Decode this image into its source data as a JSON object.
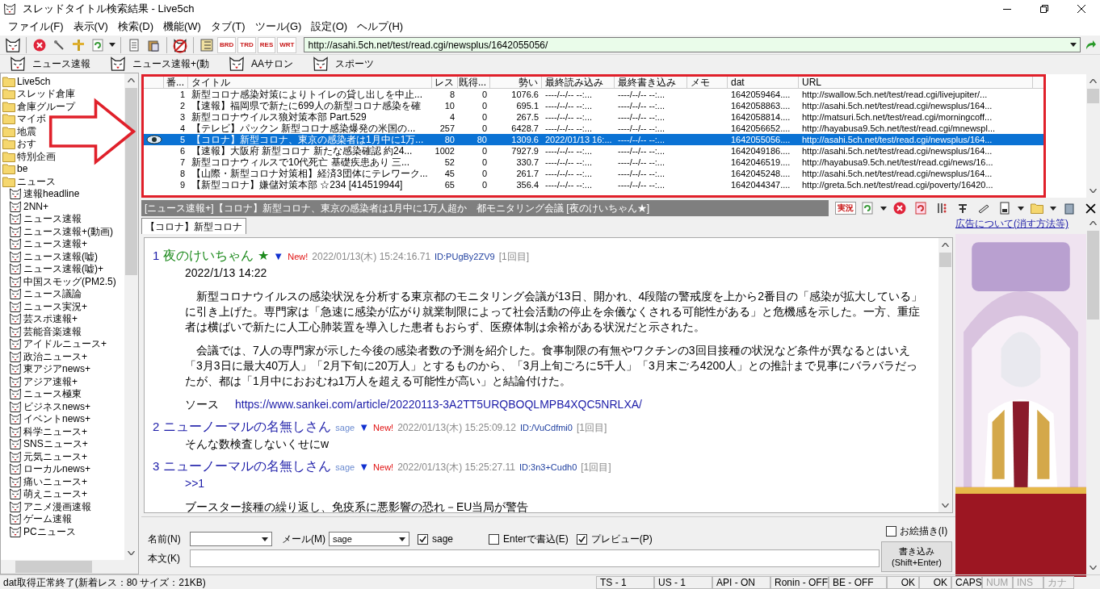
{
  "window": {
    "title": "スレッドタイトル検索結果 - Live5ch"
  },
  "menu": [
    "ファイル(F)",
    "表示(V)",
    "検索(D)",
    "機能(W)",
    "タブ(T)",
    "ツール(G)",
    "設定(O)",
    "ヘルプ(H)"
  ],
  "toolbar": {
    "letter_buttons": [
      "BRD",
      "TRD",
      "RES",
      "WRT"
    ],
    "address": "http://asahi.5ch.net/test/read.cgi/newsplus/1642055056/"
  },
  "favorites": [
    "ニュース速報",
    "ニュース速報+(動",
    "AAサロン",
    "スポーツ"
  ],
  "sidebar": {
    "items": [
      {
        "label": "Live5ch",
        "kind": "folder"
      },
      {
        "label": "スレッド倉庫",
        "kind": "folder"
      },
      {
        "label": "倉庫グループ",
        "kind": "folder"
      },
      {
        "label": "マイボ",
        "kind": "folder"
      },
      {
        "label": "地震",
        "kind": "folder"
      },
      {
        "label": "おす",
        "kind": "folder"
      },
      {
        "label": "特別企画",
        "kind": "folder"
      },
      {
        "label": "be",
        "kind": "folder"
      },
      {
        "label": "ニュース",
        "kind": "folder",
        "children": [
          {
            "label": "速報headline",
            "kind": "board"
          },
          {
            "label": "2NN+",
            "kind": "board"
          },
          {
            "label": "ニュース速報",
            "kind": "board"
          },
          {
            "label": "ニュース速報+(動画)",
            "kind": "board"
          },
          {
            "label": "ニュース速報+",
            "kind": "board"
          },
          {
            "label": "ニュース速報(嘘)",
            "kind": "board"
          },
          {
            "label": "ニュース速報(嘘)+",
            "kind": "board"
          },
          {
            "label": "中国スモッグ(PM2.5)",
            "kind": "board"
          },
          {
            "label": "ニュース議論",
            "kind": "board"
          },
          {
            "label": "ニュース実況+",
            "kind": "board"
          },
          {
            "label": "芸スポ速報+",
            "kind": "board"
          },
          {
            "label": "芸能音楽速報",
            "kind": "board"
          },
          {
            "label": "アイドルニュース+",
            "kind": "board"
          },
          {
            "label": "政治ニュース+",
            "kind": "board"
          },
          {
            "label": "東アジアnews+",
            "kind": "board"
          },
          {
            "label": "アジア速報+",
            "kind": "board"
          },
          {
            "label": "ニュース極東",
            "kind": "board"
          },
          {
            "label": "ビジネスnews+",
            "kind": "board"
          },
          {
            "label": "イベントnews+",
            "kind": "board"
          },
          {
            "label": "科学ニュース+",
            "kind": "board"
          },
          {
            "label": "SNSニュース+",
            "kind": "board"
          },
          {
            "label": "元気ニュース+",
            "kind": "board"
          },
          {
            "label": "ローカルnews+",
            "kind": "board"
          },
          {
            "label": "痛いニュース+",
            "kind": "board"
          },
          {
            "label": "萌えニュース+",
            "kind": "board"
          },
          {
            "label": "アニメ漫画速報",
            "kind": "board"
          },
          {
            "label": "ゲーム速報",
            "kind": "board"
          },
          {
            "label": "PCニュース",
            "kind": "board"
          }
        ]
      }
    ]
  },
  "table": {
    "columns": [
      "番...",
      "タイトル",
      "レス",
      "既得...",
      "勢い",
      "最終読み込み",
      "最終書き込み",
      "メモ",
      "dat",
      "URL"
    ],
    "rows": [
      {
        "no": "1",
        "title": "新型コロナ感染対策によりトイレの貸し出しを中止...",
        "res": "8",
        "got": "0",
        "momentum": "1076.6",
        "last_read": "----/--/-- --:...",
        "last_write": "----/--/-- --:...",
        "dat": "1642059464....",
        "url": "http://swallow.5ch.net/test/read.cgi/livejupiter/...",
        "selected": false
      },
      {
        "no": "2",
        "title": "【速報】福岡県で新たに699人の新型コロナ感染を確",
        "res": "10",
        "got": "0",
        "momentum": "695.1",
        "last_read": "----/--/-- --:...",
        "last_write": "----/--/-- --:...",
        "dat": "1642058863....",
        "url": "http://asahi.5ch.net/test/read.cgi/newsplus/164...",
        "selected": false
      },
      {
        "no": "3",
        "title": "新型コロナウイルス狼対策本部 Part.529",
        "res": "4",
        "got": "0",
        "momentum": "267.5",
        "last_read": "----/--/-- --:...",
        "last_write": "----/--/-- --:...",
        "dat": "1642058814....",
        "url": "http://matsuri.5ch.net/test/read.cgi/morningcoff...",
        "selected": false
      },
      {
        "no": "4",
        "title": "【テレビ】パックン  新型コロナ感染爆発の米国の...",
        "res": "257",
        "got": "0",
        "momentum": "6428.7",
        "last_read": "----/--/-- --:...",
        "last_write": "----/--/-- --:...",
        "dat": "1642056652....",
        "url": "http://hayabusa9.5ch.net/test/read.cgi/mnewspl...",
        "selected": false
      },
      {
        "no": "5",
        "title": "【コロナ】新型コロナ、東京の感染者は1月中に1万...",
        "res": "80",
        "got": "80",
        "momentum": "1309.6",
        "last_read": "2022/01/13 16:...",
        "last_write": "----/--/-- --:...",
        "dat": "1642055056....",
        "url": "http://asahi.5ch.net/test/read.cgi/newsplus/164...",
        "selected": true
      },
      {
        "no": "6",
        "title": "【速報】大阪府 新型コロナ 新たな感染確認 約24...",
        "res": "1002",
        "got": "0",
        "momentum": "7927.9",
        "last_read": "----/--/-- --:...",
        "last_write": "----/--/-- --:...",
        "dat": "1642049186....",
        "url": "http://asahi.5ch.net/test/read.cgi/newsplus/164...",
        "selected": false
      },
      {
        "no": "7",
        "title": "新型コロナウィルスで10代死亡 基礎疾患あり 三...",
        "res": "52",
        "got": "0",
        "momentum": "330.7",
        "last_read": "----/--/-- --:...",
        "last_write": "----/--/-- --:...",
        "dat": "1642046519....",
        "url": "http://hayabusa9.5ch.net/test/read.cgi/news/16...",
        "selected": false
      },
      {
        "no": "8",
        "title": "【山際・新型コロナ対策相】経済3団体にテレワーク...",
        "res": "45",
        "got": "0",
        "momentum": "261.7",
        "last_read": "----/--/-- --:...",
        "last_write": "----/--/-- --:...",
        "dat": "1642045248....",
        "url": "http://asahi.5ch.net/test/read.cgi/newsplus/164...",
        "selected": false
      },
      {
        "no": "9",
        "title": "【新型コロナ】嫌儲対策本部 ☆234 [414519944]",
        "res": "65",
        "got": "0",
        "momentum": "356.4",
        "last_read": "----/--/-- --:...",
        "last_write": "----/--/-- --:...",
        "dat": "1642044347....",
        "url": "http://greta.5ch.net/test/read.cgi/poverty/16420...",
        "selected": false
      }
    ]
  },
  "thread": {
    "title": "[ニュース速報+]【コロナ】新型コロナ、東京の感染者は1月中に1万人超か　都モニタリング会議 [夜のけいちゃん★]",
    "live_button": "実況",
    "tabs": [
      {
        "label": "【コロナ】新型コロナ",
        "selected": true
      }
    ],
    "posts": [
      {
        "no": "1",
        "name": "夜のけいちゃん",
        "color": "#1c8a1c",
        "mark": "★",
        "arrow": "▼",
        "new": "New!",
        "date": "2022/01/13(木) 15:24:16.71",
        "id": "ID:PUgBy2ZV9",
        "count": "[1回目]",
        "body": [
          {
            "kind": "text",
            "text": "2022/1/13 14:22"
          },
          {
            "kind": "gap"
          },
          {
            "kind": "text",
            "text": "　新型コロナウイルスの感染状況を分析する東京都のモニタリング会議が13日、開かれ、4段階の警戒度を上から2番目の「感染が拡大している」に引き上げた。専門家は「急速に感染が広がり就業制限によって社会活動の停止を余儀なくされる可能性がある」と危機感を示した。一方、重症者は横ばいで新たに人工心肺装置を導入した患者もおらず、医療体制は余裕がある状況だと示された。"
          },
          {
            "kind": "gap"
          },
          {
            "kind": "text",
            "text": "　会議では、7人の専門家が示した今後の感染者数の予測を紹介した。食事制限の有無やワクチンの3回目接種の状況など条件が異なるとはいえ「3月3日に最大40万人」「2月下旬に20万人」とするものから、「3月上旬ごろに5千人」「3月末ごろ4200人」との推計まで見事にバラバラだったが、都は「1月中におおむね1万人を超える可能性が高い」と結論付けた。"
          },
          {
            "kind": "gap"
          },
          {
            "kind": "source",
            "text": "ソース",
            "url": "https://www.sankei.com/article/20220113-3A2TT5URQBOQLMPB4XQC5NRLXA/"
          }
        ]
      },
      {
        "no": "2",
        "name": "ニューノーマルの名無しさん",
        "color": "#1c1ca8",
        "mail": "sage",
        "arrow": "▼",
        "new": "New!",
        "date": "2022/01/13(木) 15:25:09.12",
        "id": "ID:/VuCdfmi0",
        "count": "[1回目]",
        "body": [
          {
            "kind": "text",
            "text": "そんな数検査しないくせにw"
          }
        ]
      },
      {
        "no": "3",
        "name": "ニューノーマルの名無しさん",
        "color": "#1c1ca8",
        "mail": "sage",
        "arrow": "▼",
        "new": "New!",
        "date": "2022/01/13(木) 15:25:27.11",
        "id": "ID:3n3+Cudh0",
        "count": "[1回目]",
        "body": [
          {
            "kind": "anchor",
            "text": ">>1"
          },
          {
            "kind": "gap"
          },
          {
            "kind": "text",
            "text": "ブースター接種の繰り返し、免疫系に悪影響の恐れ－EU当局が警告"
          }
        ]
      }
    ]
  },
  "ad": {
    "link": "広告について(消す方法等)",
    "kind": "picture"
  },
  "form": {
    "name_label": "名前(N)",
    "mail_label": "メール(M)",
    "mail_value": "sage",
    "body_label": "本文(K)",
    "checks": [
      {
        "label": "sage",
        "checked": true
      },
      {
        "label": "Enterで書込(E)",
        "checked": false
      },
      {
        "label": "プレビュー(P)",
        "checked": true
      }
    ],
    "draw_check": {
      "label": "お絵描き(I)",
      "checked": false
    },
    "submit": [
      "書き込み",
      "(Shift+Enter)"
    ]
  },
  "status_bar": {
    "message": "dat取得正常終了(新着レス：80  サイズ：21KB)",
    "panels": [
      "TS - 1",
      "US - 1",
      "API - ON",
      "Ronin - OFF",
      "BE - OFF",
      "OK",
      "OK"
    ],
    "indicators": [
      {
        "text": "CAPS",
        "on": true
      },
      {
        "text": "NUM",
        "on": false
      },
      {
        "text": "INS",
        "on": false
      },
      {
        "text": "カナ",
        "on": false
      }
    ]
  }
}
